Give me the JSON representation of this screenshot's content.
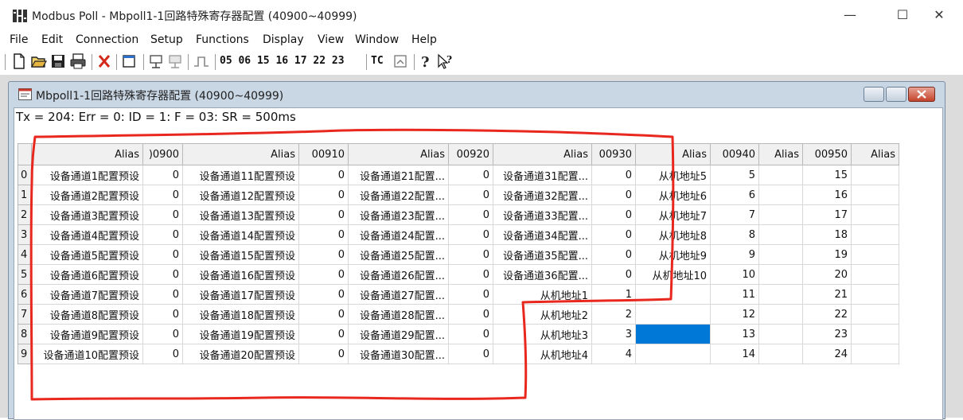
{
  "app": {
    "title": "Modbus Poll - Mbpoll1-1回路特殊寄存器配置 (40900~40999)",
    "minimize": "—",
    "maximize": "☐",
    "close": "✕"
  },
  "menu": [
    "File",
    "Edit",
    "Connection",
    "Setup",
    "Functions",
    "Display",
    "View",
    "Window",
    "Help"
  ],
  "toolbar": {
    "codes": "05 06 15 16 17 22 23",
    "tc": "TC",
    "icons": [
      "new-icon",
      "open-icon",
      "save-icon",
      "print-icon",
      "delete-icon",
      "window-icon",
      "connect-icon",
      "disconnect-icon",
      "pulse-icon",
      "read-write-icon",
      "help-icon",
      "context-help-icon"
    ]
  },
  "child": {
    "title": "Mbpoll1-1回路特殊寄存器配置 (40900~40999)",
    "status": "Tx = 204: Err = 0: ID = 1: F = 03: SR = 500ms"
  },
  "grid": {
    "headers": [
      "",
      "Alias",
      ")0900",
      "Alias",
      "00910",
      "Alias",
      "00920",
      "Alias",
      "00930",
      "Alias",
      "00940",
      "Alias",
      "00950",
      "Alias"
    ],
    "rows": [
      [
        "0",
        "设备通道1配置预设",
        "0",
        "设备通道11配置预设",
        "0",
        "设备通道21配置...",
        "0",
        "设备通道31配置...",
        "0",
        "从机地址5",
        "5",
        "",
        "15",
        ""
      ],
      [
        "1",
        "设备通道2配置预设",
        "0",
        "设备通道12配置预设",
        "0",
        "设备通道22配置...",
        "0",
        "设备通道32配置...",
        "0",
        "从机地址6",
        "6",
        "",
        "16",
        ""
      ],
      [
        "2",
        "设备通道3配置预设",
        "0",
        "设备通道13配置预设",
        "0",
        "设备通道23配置...",
        "0",
        "设备通道33配置...",
        "0",
        "从机地址7",
        "7",
        "",
        "17",
        ""
      ],
      [
        "3",
        "设备通道4配置预设",
        "0",
        "设备通道14配置预设",
        "0",
        "设备通道24配置...",
        "0",
        "设备通道34配置...",
        "0",
        "从机地址8",
        "8",
        "",
        "18",
        ""
      ],
      [
        "4",
        "设备通道5配置预设",
        "0",
        "设备通道15配置预设",
        "0",
        "设备通道25配置...",
        "0",
        "设备通道35配置...",
        "0",
        "从机地址9",
        "9",
        "",
        "19",
        ""
      ],
      [
        "5",
        "设备通道6配置预设",
        "0",
        "设备通道16配置预设",
        "0",
        "设备通道26配置...",
        "0",
        "设备通道36配置...",
        "0",
        "从机地址10",
        "10",
        "",
        "20",
        ""
      ],
      [
        "6",
        "设备通道7配置预设",
        "0",
        "设备通道17配置预设",
        "0",
        "设备通道27配置...",
        "0",
        "从机地址1",
        "1",
        "",
        "11",
        "",
        "21",
        ""
      ],
      [
        "7",
        "设备通道8配置预设",
        "0",
        "设备通道18配置预设",
        "0",
        "设备通道28配置...",
        "0",
        "从机地址2",
        "2",
        "",
        "12",
        "",
        "22",
        ""
      ],
      [
        "8",
        "设备通道9配置预设",
        "0",
        "设备通道19配置预设",
        "0",
        "设备通道29配置...",
        "0",
        "从机地址3",
        "3",
        "",
        "13",
        "",
        "23",
        ""
      ],
      [
        "9",
        "设备通道10配置预设",
        "0",
        "设备通道20配置预设",
        "0",
        "设备通道30配置...",
        "0",
        "从机地址4",
        "4",
        "",
        "14",
        "",
        "24",
        ""
      ]
    ],
    "selected": {
      "row": 8,
      "col": 9
    }
  },
  "colors": {
    "selection": "#0078d7",
    "annotation": "#e8281e",
    "close_button": "#c4432b"
  }
}
